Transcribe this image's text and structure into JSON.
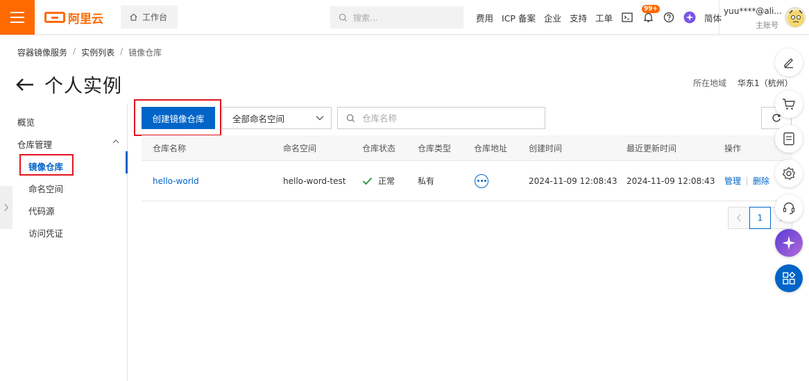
{
  "brand": {
    "name": "阿里云",
    "accent": "#ff6a00",
    "primary": "#0064c8",
    "highlight": "#e0141e"
  },
  "topbar": {
    "workbench_label": "工作台",
    "search_placeholder": "搜索...",
    "links": [
      "费用",
      "ICP 备案",
      "企业",
      "支持",
      "工单"
    ],
    "notification_badge": "99+",
    "language": "简体",
    "user_name": "yuu****@ali...",
    "user_role": "主账号"
  },
  "breadcrumb": [
    "容器镜像服务",
    "实例列表",
    "镜像仓库"
  ],
  "page": {
    "title": "个人实例",
    "region_label": "所在地域",
    "region_value": "华东1（杭州）"
  },
  "sidebar": {
    "overview": "概览",
    "group_label": "仓库管理",
    "items": [
      "镜像仓库",
      "命名空间",
      "代码源",
      "访问凭证"
    ]
  },
  "toolbar": {
    "create_label": "创建镜像仓库",
    "namespace_select": "全部命名空间",
    "search_placeholder": "仓库名称"
  },
  "table": {
    "columns": [
      "仓库名称",
      "命名空间",
      "仓库状态",
      "仓库类型",
      "仓库地址",
      "创建时间",
      "最近更新时间",
      "操作"
    ],
    "rows": [
      {
        "name": "hello-world",
        "namespace": "hello-word-test",
        "status": "正常",
        "type": "私有",
        "created": "2024-11-09 12:08:43",
        "updated": "2024-11-09 12:08:43",
        "action_manage": "管理",
        "action_delete": "删除"
      }
    ]
  },
  "pagination": {
    "current": "1"
  },
  "float_tools": [
    "edit-icon",
    "cart-icon",
    "app-icon",
    "settings-icon",
    "headset-icon",
    "ai-assistant-icon",
    "apps-grid-icon"
  ]
}
